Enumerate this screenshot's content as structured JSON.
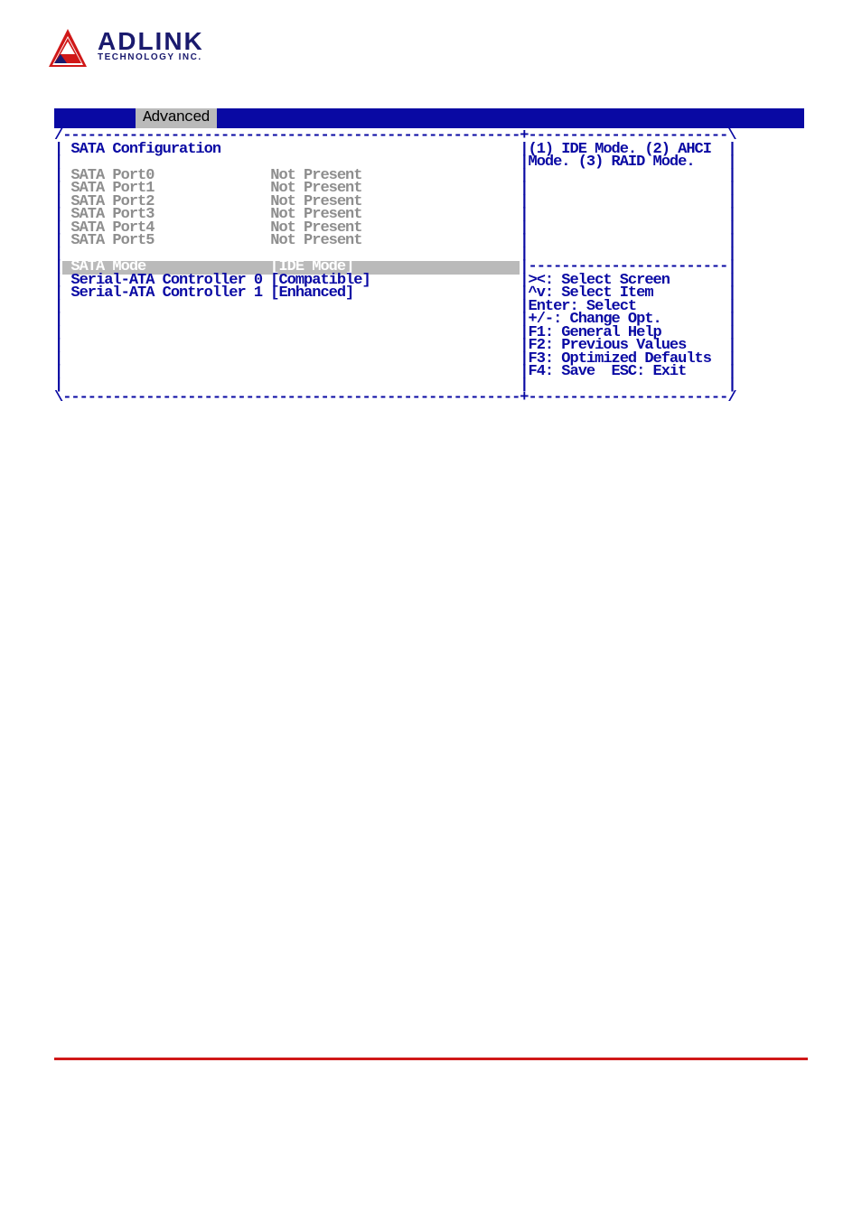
{
  "logo": {
    "main": "ADLINK",
    "sub": "TECHNOLOGY INC."
  },
  "tab": "Advanced",
  "section_title": "SATA Configuration",
  "ports": [
    {
      "label": "SATA Port0",
      "value": "Not Present"
    },
    {
      "label": "SATA Port1",
      "value": "Not Present"
    },
    {
      "label": "SATA Port2",
      "value": "Not Present"
    },
    {
      "label": "SATA Port3",
      "value": "Not Present"
    },
    {
      "label": "SATA Port4",
      "value": "Not Present"
    },
    {
      "label": "SATA Port5",
      "value": "Not Present"
    }
  ],
  "settings": [
    {
      "label": "SATA Mode",
      "value": "[IDE Mode]",
      "selected": true
    },
    {
      "label": "Serial-ATA Controller 0",
      "value": "[Compatible]",
      "selected": false
    },
    {
      "label": "Serial-ATA Controller 1",
      "value": "[Enhanced]",
      "selected": false
    }
  ],
  "help_text": [
    "(1) IDE Mode. (2) AHCI",
    "Mode. (3) RAID Mode."
  ],
  "nav_help": [
    "><: Select Screen",
    "^v: Select Item",
    "Enter: Select",
    "+/-: Change Opt.",
    "F1: General Help",
    "F2: Previous Values",
    "F3: Optimized Defaults",
    "F4: Save  ESC: Exit"
  ],
  "layout": {
    "total_cols": 82,
    "left_cols": 56,
    "right_cols": 25,
    "label_col": 2,
    "value_col": 26
  }
}
